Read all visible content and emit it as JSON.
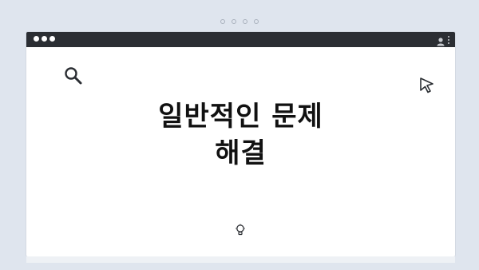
{
  "headline": "일반적인 문제\n해결",
  "icons": {
    "search": "magnifier-icon",
    "cursor": "mouse-pointer-icon",
    "bulb": "lightbulb-icon",
    "user": "user-icon",
    "menu": "kebab-menu-icon"
  },
  "colors": {
    "background": "#dfe5ee",
    "titlebar": "#2b2e33",
    "window": "#ffffff",
    "text": "#111111"
  }
}
